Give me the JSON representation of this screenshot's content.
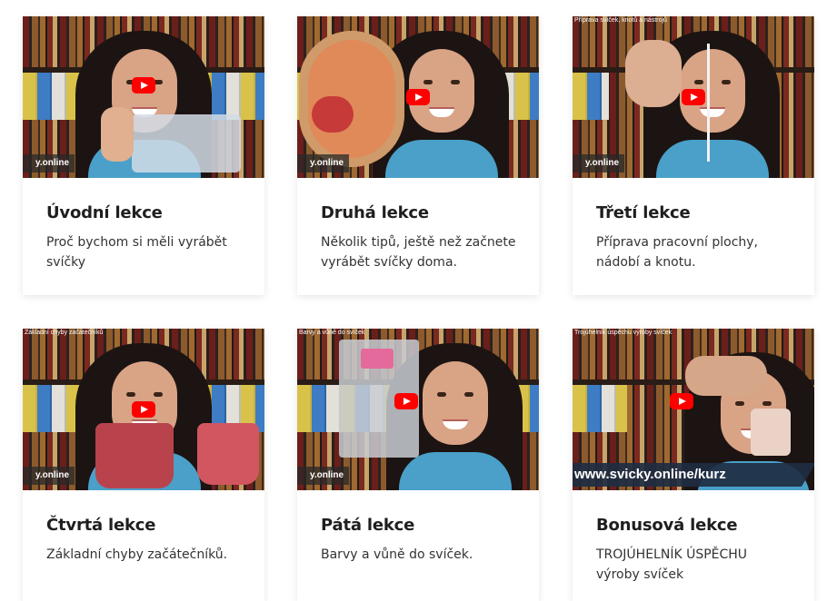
{
  "lessons": [
    {
      "title": "Úvodní lekce",
      "description": "Proč bychom si měli vyrábět svíčky",
      "video_title": "",
      "brand": "y.online"
    },
    {
      "title": "Druhá lekce",
      "description": "Několik tipů, ještě než začnete vyrábět svíčky doma.",
      "video_title": "",
      "brand": "y.online"
    },
    {
      "title": "Třetí lekce",
      "description": "Příprava pracovní plochy, nádobí a knotu.",
      "video_title": "Příprava svíček, knotů a nástrojů",
      "brand": "y.online"
    },
    {
      "title": "Čtvrtá lekce",
      "description": "Základní chyby začátečníků.",
      "video_title": "Základní chyby začátečníků",
      "brand": "y.online"
    },
    {
      "title": "Pátá lekce",
      "description": "Barvy a vůně do svíček.",
      "video_title": "Barvy a vůně do svíček",
      "brand": "y.online"
    },
    {
      "title": "Bonusová lekce",
      "description": "TROJÚHELNÍK ÚSPĚCHU výroby svíček",
      "video_title": "Trojúhelník úspěchu výroby svíček",
      "banner": "www.svicky.online/kurz"
    }
  ],
  "colors": {
    "play_button": "#ff0000",
    "card_bg": "#ffffff",
    "title": "#1f1f1f"
  },
  "icons": {
    "play": "youtube-play-icon"
  }
}
